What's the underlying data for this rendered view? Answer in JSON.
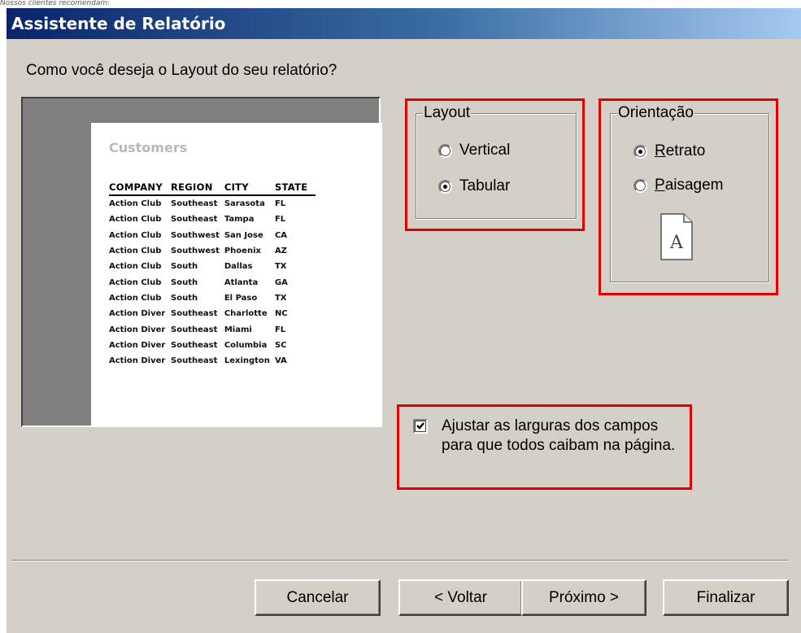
{
  "caption": "Nossos clientes recomendam:",
  "window": {
    "title": "Assistente de Relatório"
  },
  "question": "Como você deseja o Layout do seu relatório?",
  "preview": {
    "title": "Customers",
    "columns": [
      "COMPANY",
      "REGION",
      "CITY",
      "STATE"
    ],
    "rows": [
      [
        "Action Club",
        "Southeast",
        "Sarasota",
        "FL"
      ],
      [
        "Action Club",
        "Southeast",
        "Tampa",
        "FL"
      ],
      [
        "Action Club",
        "Southwest",
        "San Jose",
        "CA"
      ],
      [
        "Action Club",
        "Southwest",
        "Phoenix",
        "AZ"
      ],
      [
        "Action Club",
        "South",
        "Dallas",
        "TX"
      ],
      [
        "Action Club",
        "South",
        "Atlanta",
        "GA"
      ],
      [
        "Action Club",
        "South",
        "El Paso",
        "TX"
      ],
      [
        "Action Diver",
        "Southeast",
        "Charlotte",
        "NC"
      ],
      [
        "Action Diver",
        "Southeast",
        "Miami",
        "FL"
      ],
      [
        "Action Diver",
        "Southeast",
        "Columbia",
        "SC"
      ],
      [
        "Action Diver",
        "Southeast",
        "Lexington",
        "VA"
      ]
    ]
  },
  "layout_group": {
    "label": "Layout",
    "options": [
      {
        "label": "Vertical",
        "checked": false
      },
      {
        "label": "Tabular",
        "checked": true
      }
    ]
  },
  "orientation_group": {
    "label": "Orientação",
    "options": [
      {
        "label_first": "R",
        "label_rest": "etrato",
        "checked": true
      },
      {
        "label_first": "P",
        "label_rest": "aisagem",
        "checked": false
      }
    ],
    "icon": "portrait-page-icon",
    "icon_letter": "A"
  },
  "fit_fields": {
    "checked": true,
    "label": "Ajustar as larguras dos campos para que todos caibam na página."
  },
  "buttons": {
    "cancel": "Cancelar",
    "back": "< Voltar",
    "next": "Próximo >",
    "finish": "Finalizar"
  },
  "colors": {
    "dialog_bg": "#d4d0c8",
    "title_start": "#0a246a",
    "title_end": "#a6caf0",
    "highlight": "#e00000"
  }
}
